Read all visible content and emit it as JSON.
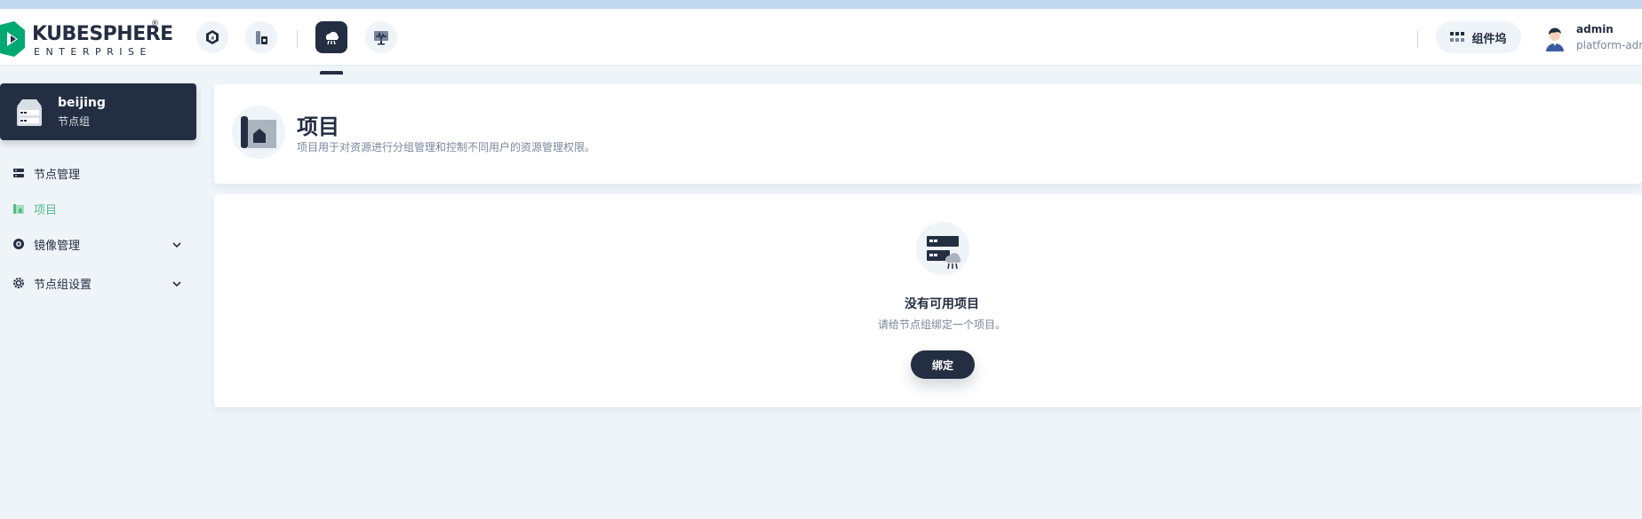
{
  "brand": {
    "name": "KUBESPHERE",
    "sub": "ENTERPRISE",
    "reg": "®"
  },
  "header": {
    "nav_icons": [
      "workspace-icon",
      "cluster-icon",
      "edge-node-icon",
      "monitoring-icon"
    ],
    "workbench_label": "组件坞",
    "user_name": "admin",
    "user_role": "platform-admin"
  },
  "sidebar": {
    "group_name": "beijing",
    "group_type": "节点组",
    "items": [
      {
        "label": "节点管理",
        "icon": "node-icon"
      },
      {
        "label": "项目",
        "icon": "project-icon",
        "active": true
      },
      {
        "label": "镜像管理",
        "icon": "image-icon",
        "expandable": true
      },
      {
        "label": "节点组设置",
        "icon": "settings-icon",
        "expandable": true
      }
    ]
  },
  "main": {
    "title": "项目",
    "description": "项目用于对资源进行分组管理和控制不同用户的资源管理权限。",
    "empty_title": "没有可用项目",
    "empty_desc": "请给节点组绑定一个项目。",
    "bind_label": "绑定"
  },
  "colors": {
    "accent": "#55bc8a",
    "dark": "#242e42",
    "bg": "#eff4f9"
  }
}
